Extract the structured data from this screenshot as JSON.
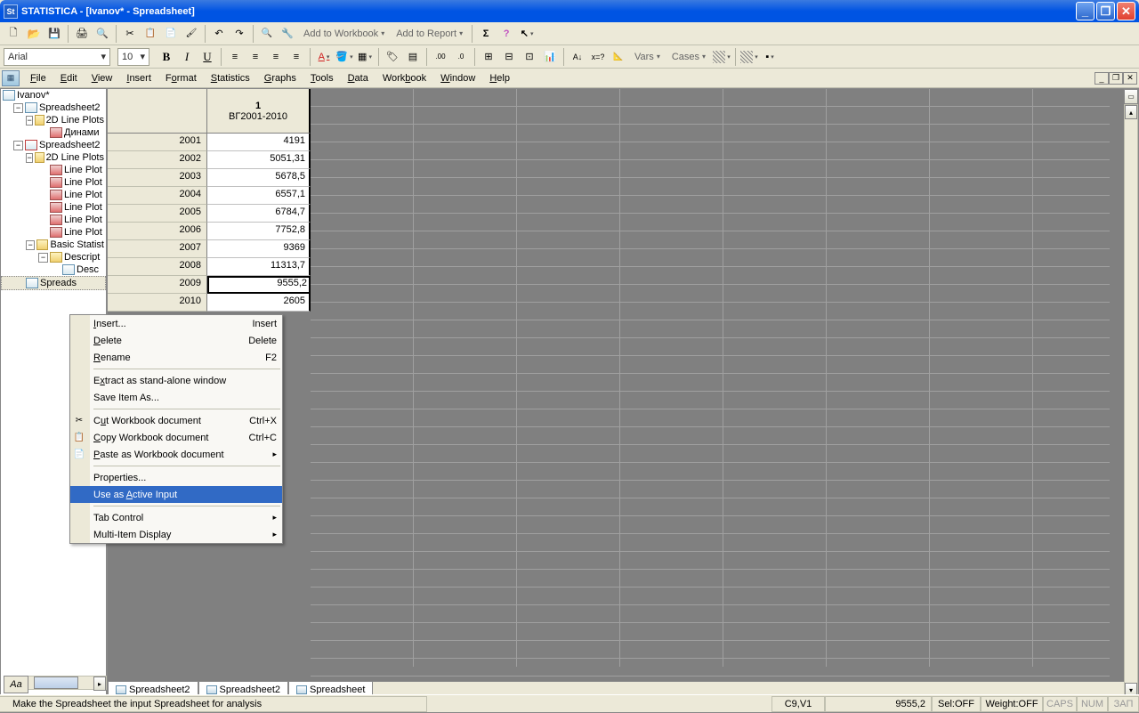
{
  "window": {
    "title": "STATISTICA - [Ivanov* - Spreadsheet]"
  },
  "toolbar1": {
    "add_workbook": "Add to Workbook",
    "add_report": "Add to Report"
  },
  "toolbar2": {
    "font": "Arial",
    "size": "10",
    "vars": "Vars",
    "cases": "Cases"
  },
  "menubar": {
    "file": "File",
    "edit": "Edit",
    "view": "View",
    "insert": "Insert",
    "format": "Format",
    "statistics": "Statistics",
    "graphs": "Graphs",
    "tools": "Tools",
    "data": "Data",
    "workbook": "Workbook",
    "window": "Window",
    "help": "Help"
  },
  "tree": {
    "root": "Ivanov*",
    "items": [
      "Spreadsheet2",
      "2D Line Plots",
      "Динами",
      "Spreadsheet2",
      "2D Line Plots",
      "Line Plot",
      "Line Plot",
      "Line Plot",
      "Line Plot",
      "Line Plot",
      "Line Plot",
      "Basic Statist",
      "Descript",
      "Desc",
      "Spreads"
    ]
  },
  "sheet": {
    "col_num": "1",
    "col_name": "ВГ2001-2010",
    "rows": [
      {
        "h": "2001",
        "v": "4191"
      },
      {
        "h": "2002",
        "v": "5051,31"
      },
      {
        "h": "2003",
        "v": "5678,5"
      },
      {
        "h": "2004",
        "v": "6557,1"
      },
      {
        "h": "2005",
        "v": "6784,7"
      },
      {
        "h": "2006",
        "v": "7752,8"
      },
      {
        "h": "2007",
        "v": "9369"
      },
      {
        "h": "2008",
        "v": "11313,7"
      },
      {
        "h": "2009",
        "v": "9555,2"
      },
      {
        "h": "2010",
        "v": "2605"
      }
    ],
    "tabs": [
      "Spreadsheet2",
      "Spreadsheet2",
      "Spreadsheet"
    ]
  },
  "context_menu": {
    "insert": "Insert...",
    "insert_sc": "Insert",
    "delete": "Delete",
    "delete_sc": "Delete",
    "rename": "Rename",
    "rename_sc": "F2",
    "extract": "Extract as stand-alone window",
    "saveas": "Save Item As...",
    "cut": "Cut Workbook document",
    "cut_sc": "Ctrl+X",
    "copy": "Copy Workbook document",
    "copy_sc": "Ctrl+C",
    "paste": "Paste as Workbook document",
    "properties": "Properties...",
    "active": "Use as Active Input",
    "tabcontrol": "Tab Control",
    "multidisplay": "Multi-Item Display"
  },
  "statusbar": {
    "hint": "Make the Spreadsheet the input Spreadsheet for analysis",
    "cell": "C9,V1",
    "value": "9555,2",
    "sel": "Sel:OFF",
    "weight": "Weight:OFF",
    "caps": "CAPS",
    "num": "NUM",
    "zap": "ЗАП"
  },
  "graph_btn": "Aa"
}
